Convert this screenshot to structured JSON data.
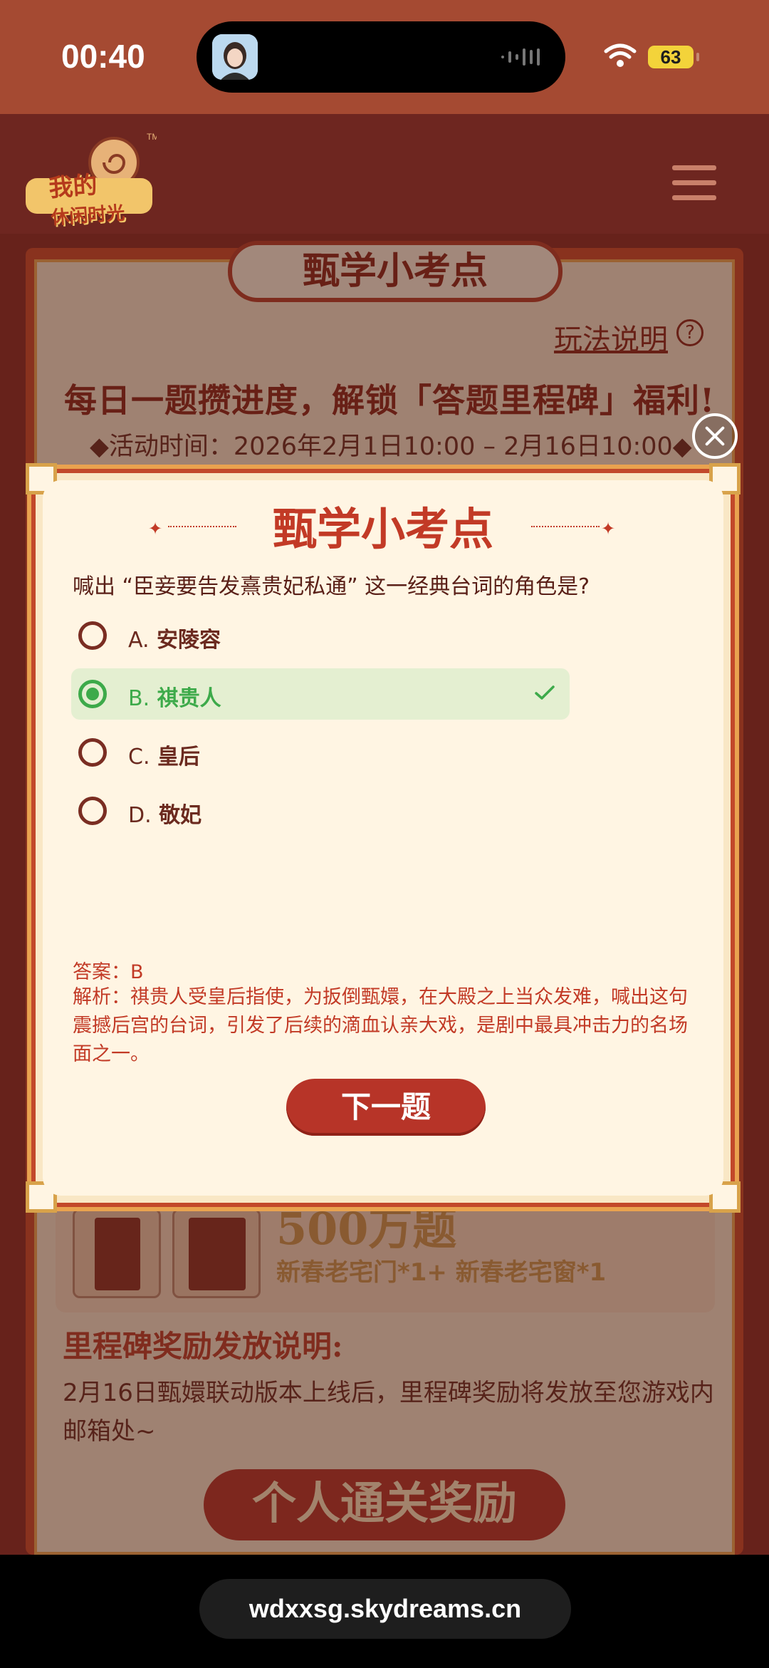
{
  "status_bar": {
    "time": "00:40",
    "battery": "63"
  },
  "background_page": {
    "logo_text_line1": "我的",
    "logo_text_line2": "休闲时光",
    "title": "甄学小考点",
    "rules_link": "玩法说明",
    "rules_icon": "?",
    "headline": "每日一题攒进度，解锁「答题里程碑」福利!",
    "activity_time": "◆活动时间：2026年2月1日10:00 – 2月16日10:00◆",
    "reward_count": "500万题",
    "reward_desc": "新春老宅门*1+ 新春老宅窗*1",
    "milestone_title": "里程碑奖励发放说明:",
    "milestone_desc": "2月16日甄嬛联动版本上线后，里程碑奖励将发放至您游戏内邮箱处~",
    "personal_reward_button": "个人通关奖励"
  },
  "modal": {
    "title": "甄学小考点",
    "question": "喊出 “臣妾要告发熹贵妃私通” 这一经典台词的角色是?",
    "options": [
      {
        "letter": "A.",
        "text": "安陵容",
        "selected": false
      },
      {
        "letter": "B.",
        "text": "祺贵人",
        "selected": true
      },
      {
        "letter": "C.",
        "text": "皇后",
        "selected": false
      },
      {
        "letter": "D.",
        "text": "敬妃",
        "selected": false
      }
    ],
    "answer": "答案：B",
    "analysis": "解析：祺贵人受皇后指使，为扳倒甄嬛，在大殿之上当众发难，喊出这句震撼后宫的台词，引发了后续的滴血认亲大戏，是剧中最具冲击力的名场面之一。",
    "next_button": "下一题"
  },
  "browser": {
    "url": "wdxxsg.skydreams.cn"
  },
  "colors": {
    "brand_red": "#b73428",
    "correct_green": "#3daa4a",
    "modal_bg": "#fff5e3"
  }
}
